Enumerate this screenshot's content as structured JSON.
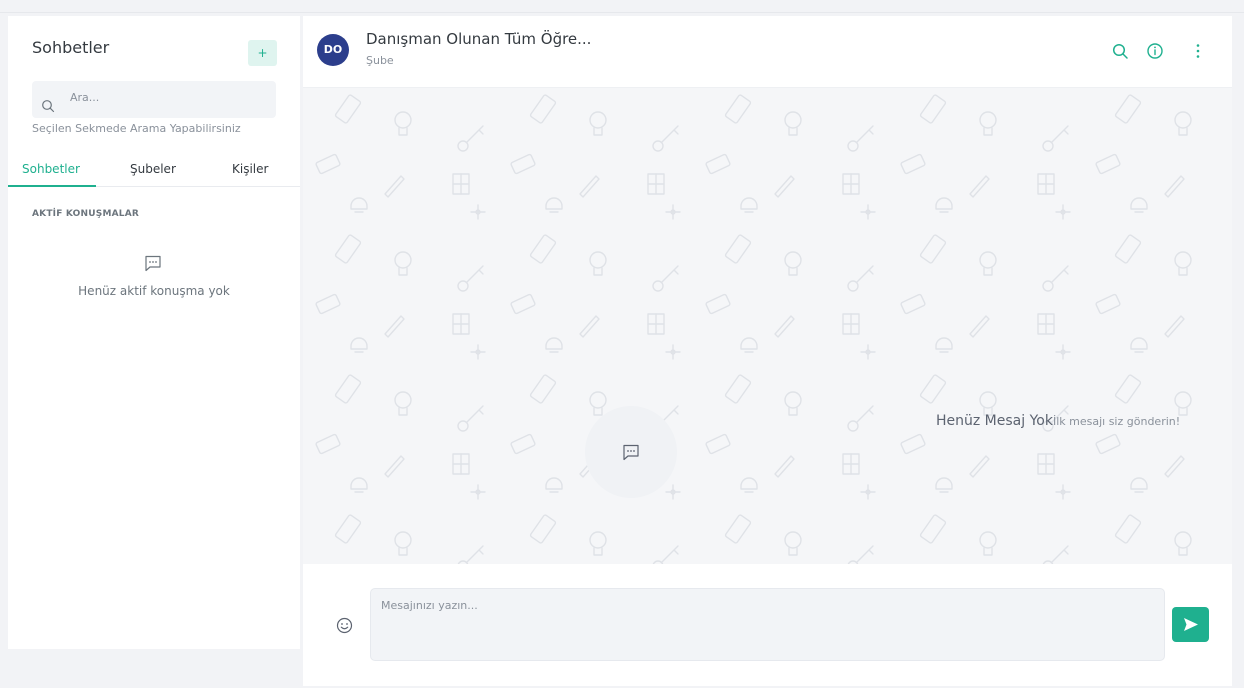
{
  "sidebar": {
    "title": "Sohbetler",
    "add_button_label": "+",
    "search": {
      "placeholder": "Ara..."
    },
    "search_hint": "Seçilen Sekmede Arama Yapabilirsiniz",
    "tabs": [
      {
        "label": "Sohbetler",
        "active": true
      },
      {
        "label": "Şubeler",
        "active": false
      },
      {
        "label": "Kişiler",
        "active": false
      }
    ],
    "section_title": "AKTİF KONUŞMALAR",
    "empty_text": "Henüz aktif konuşma yok"
  },
  "chat": {
    "avatar_initials": "DO",
    "title": "Danışman Olunan Tüm Öğre...",
    "subtitle": "Şube",
    "header_icons": [
      "search-icon",
      "info-icon",
      "more-vertical-icon"
    ],
    "empty_title": "Henüz Mesaj Yok",
    "empty_subtitle": "İlk mesajı siz gönderin!",
    "composer": {
      "placeholder": "Mesajınızı yazın..."
    }
  },
  "colors": {
    "accent": "#1fb08f",
    "avatar": "#2c3e8c",
    "chat_background": "#f5f6f8"
  }
}
